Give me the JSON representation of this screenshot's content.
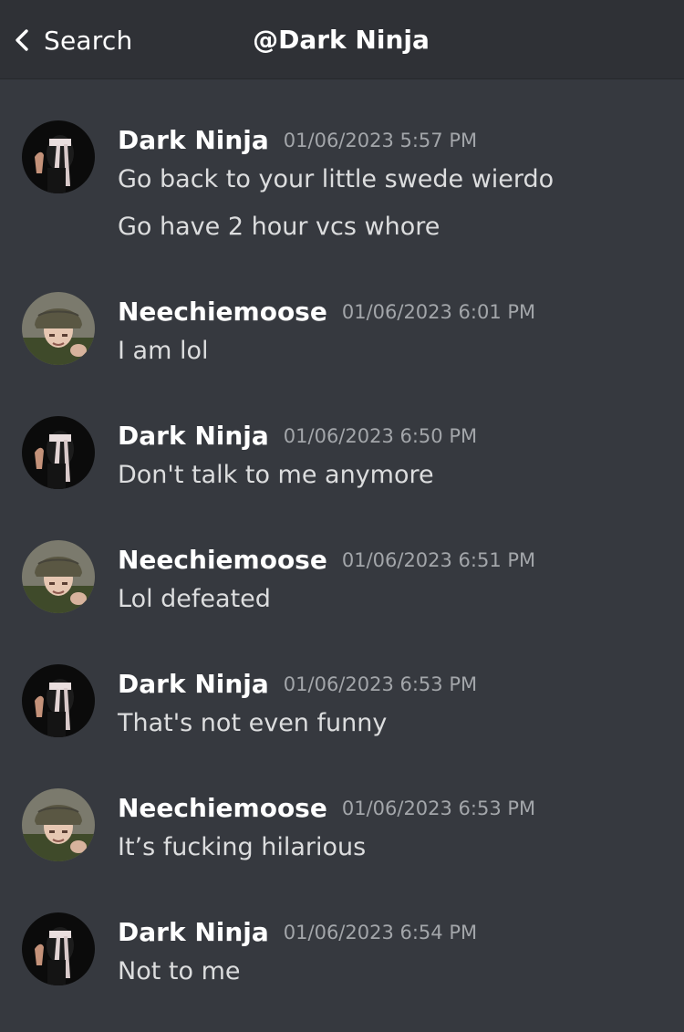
{
  "header": {
    "back_label": "Search",
    "title": "@Dark Ninja"
  },
  "colors": {
    "background": "#36393f",
    "header_bg": "#2f3136",
    "username": "#ffffff",
    "timestamp": "#a3a6aa",
    "message_text": "#dcddde"
  },
  "messages": [
    {
      "author": "Dark Ninja",
      "avatar": "ninja-avatar",
      "timestamp": "01/06/2023 5:57 PM",
      "lines": [
        "Go back to your little swede wierdo",
        "Go have 2 hour vcs whore"
      ]
    },
    {
      "author": "Neechiemoose",
      "avatar": "helmet-avatar",
      "timestamp": "01/06/2023 6:01 PM",
      "lines": [
        "I am lol"
      ]
    },
    {
      "author": "Dark Ninja",
      "avatar": "ninja-avatar",
      "timestamp": "01/06/2023 6:50 PM",
      "lines": [
        "Don't talk to me anymore"
      ]
    },
    {
      "author": "Neechiemoose",
      "avatar": "helmet-avatar",
      "timestamp": "01/06/2023 6:51 PM",
      "lines": [
        "Lol defeated"
      ]
    },
    {
      "author": "Dark Ninja",
      "avatar": "ninja-avatar",
      "timestamp": "01/06/2023 6:53 PM",
      "lines": [
        "That's not even funny"
      ]
    },
    {
      "author": "Neechiemoose",
      "avatar": "helmet-avatar",
      "timestamp": "01/06/2023 6:53 PM",
      "lines": [
        "It’s fucking hilarious"
      ]
    },
    {
      "author": "Dark Ninja",
      "avatar": "ninja-avatar",
      "timestamp": "01/06/2023 6:54 PM",
      "lines": [
        "Not to me"
      ]
    }
  ]
}
